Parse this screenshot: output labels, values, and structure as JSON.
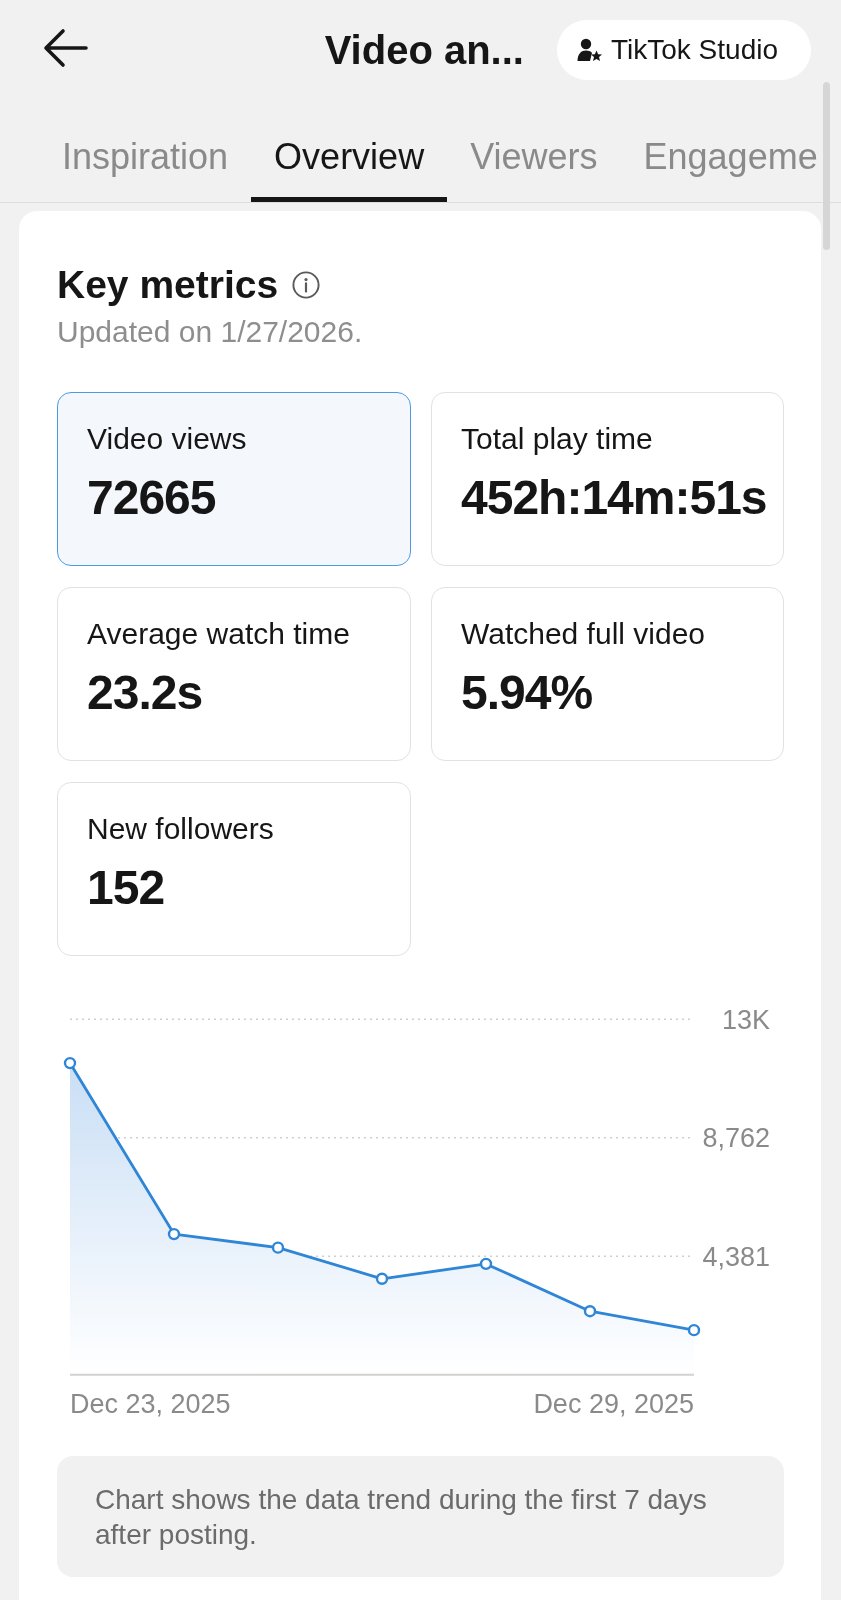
{
  "header": {
    "title": "Video an...",
    "studio_button": "TikTok Studio"
  },
  "tabs": [
    {
      "label": "Inspiration",
      "selected": false
    },
    {
      "label": "Overview",
      "selected": true
    },
    {
      "label": "Viewers",
      "selected": false
    },
    {
      "label": "Engageme",
      "selected": false
    }
  ],
  "key_metrics": {
    "title": "Key metrics",
    "updated": "Updated on 1/27/2026.",
    "metrics": [
      {
        "label": "Video views",
        "value": "72665",
        "selected": true
      },
      {
        "label": "Total play time",
        "value": "452h:14m:51s",
        "selected": false
      },
      {
        "label": "Average watch time",
        "value": "23.2s",
        "selected": false
      },
      {
        "label": "Watched full video",
        "value": "5.94%",
        "selected": false
      },
      {
        "label": "New followers",
        "value": "152",
        "selected": false
      }
    ],
    "chart_data": {
      "type": "area",
      "categories": [
        null,
        null,
        null,
        null,
        null,
        null,
        null
      ],
      "values": [
        11520,
        5200,
        4700,
        3550,
        4100,
        2350,
        1650
      ],
      "yticks": [
        {
          "value": 4381,
          "label": "4,381"
        },
        {
          "value": 8762,
          "label": "8,762"
        },
        {
          "value": 13143,
          "label": "13K"
        }
      ],
      "ylim": [
        0,
        13143
      ]
    },
    "date_range": {
      "start": "Dec 23, 2025",
      "end": "Dec 29, 2025"
    },
    "note": "Chart shows the data trend during the first 7 days after posting."
  }
}
